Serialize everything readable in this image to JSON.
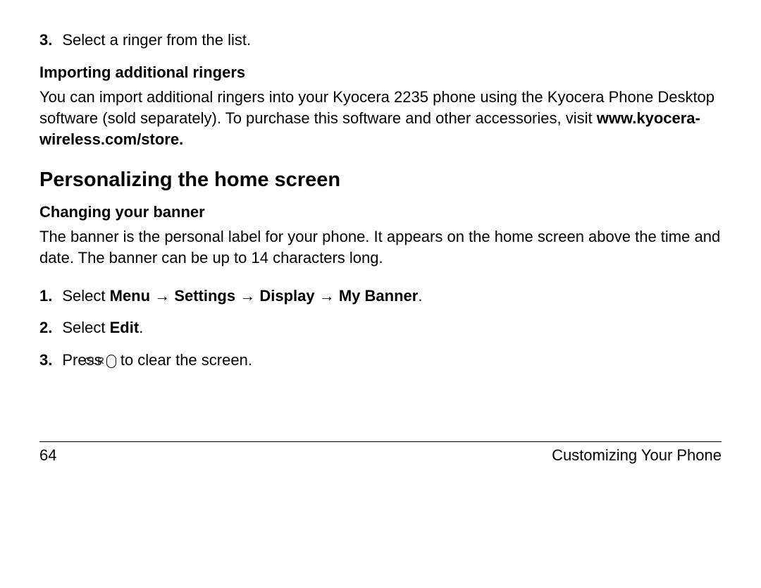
{
  "step3": {
    "num": "3.",
    "text": "Select a ringer from the list."
  },
  "subhead1": "Importing additional ringers",
  "importing_para_pre": "You can import additional ringers into your Kyocera 2235 phone using the Kyocera Phone Desktop software (sold separately). To purchase this software and other accessories, visit ",
  "importing_url": "www.kyocera-wireless.com/store.",
  "heading": "Personalizing the home screen",
  "subhead2": "Changing your banner",
  "banner_para": "The banner is the personal label for your phone. It appears on the home screen above the time and date. The banner can be up to 14 characters long.",
  "steps": {
    "s1": {
      "num": "1.",
      "pre": "Select ",
      "menu": "Menu",
      "arrow": " → ",
      "settings": "Settings",
      "display": "Display",
      "mybanner": "My Banner",
      "period": "."
    },
    "s2": {
      "num": "2.",
      "pre": "Select ",
      "edit": "Edit",
      "period": "."
    },
    "s3": {
      "num": "3.",
      "pre": "Press  ",
      "clr": "CLR",
      "post": "  to clear the screen."
    }
  },
  "footer": {
    "page": "64",
    "section": "Customizing Your Phone"
  }
}
